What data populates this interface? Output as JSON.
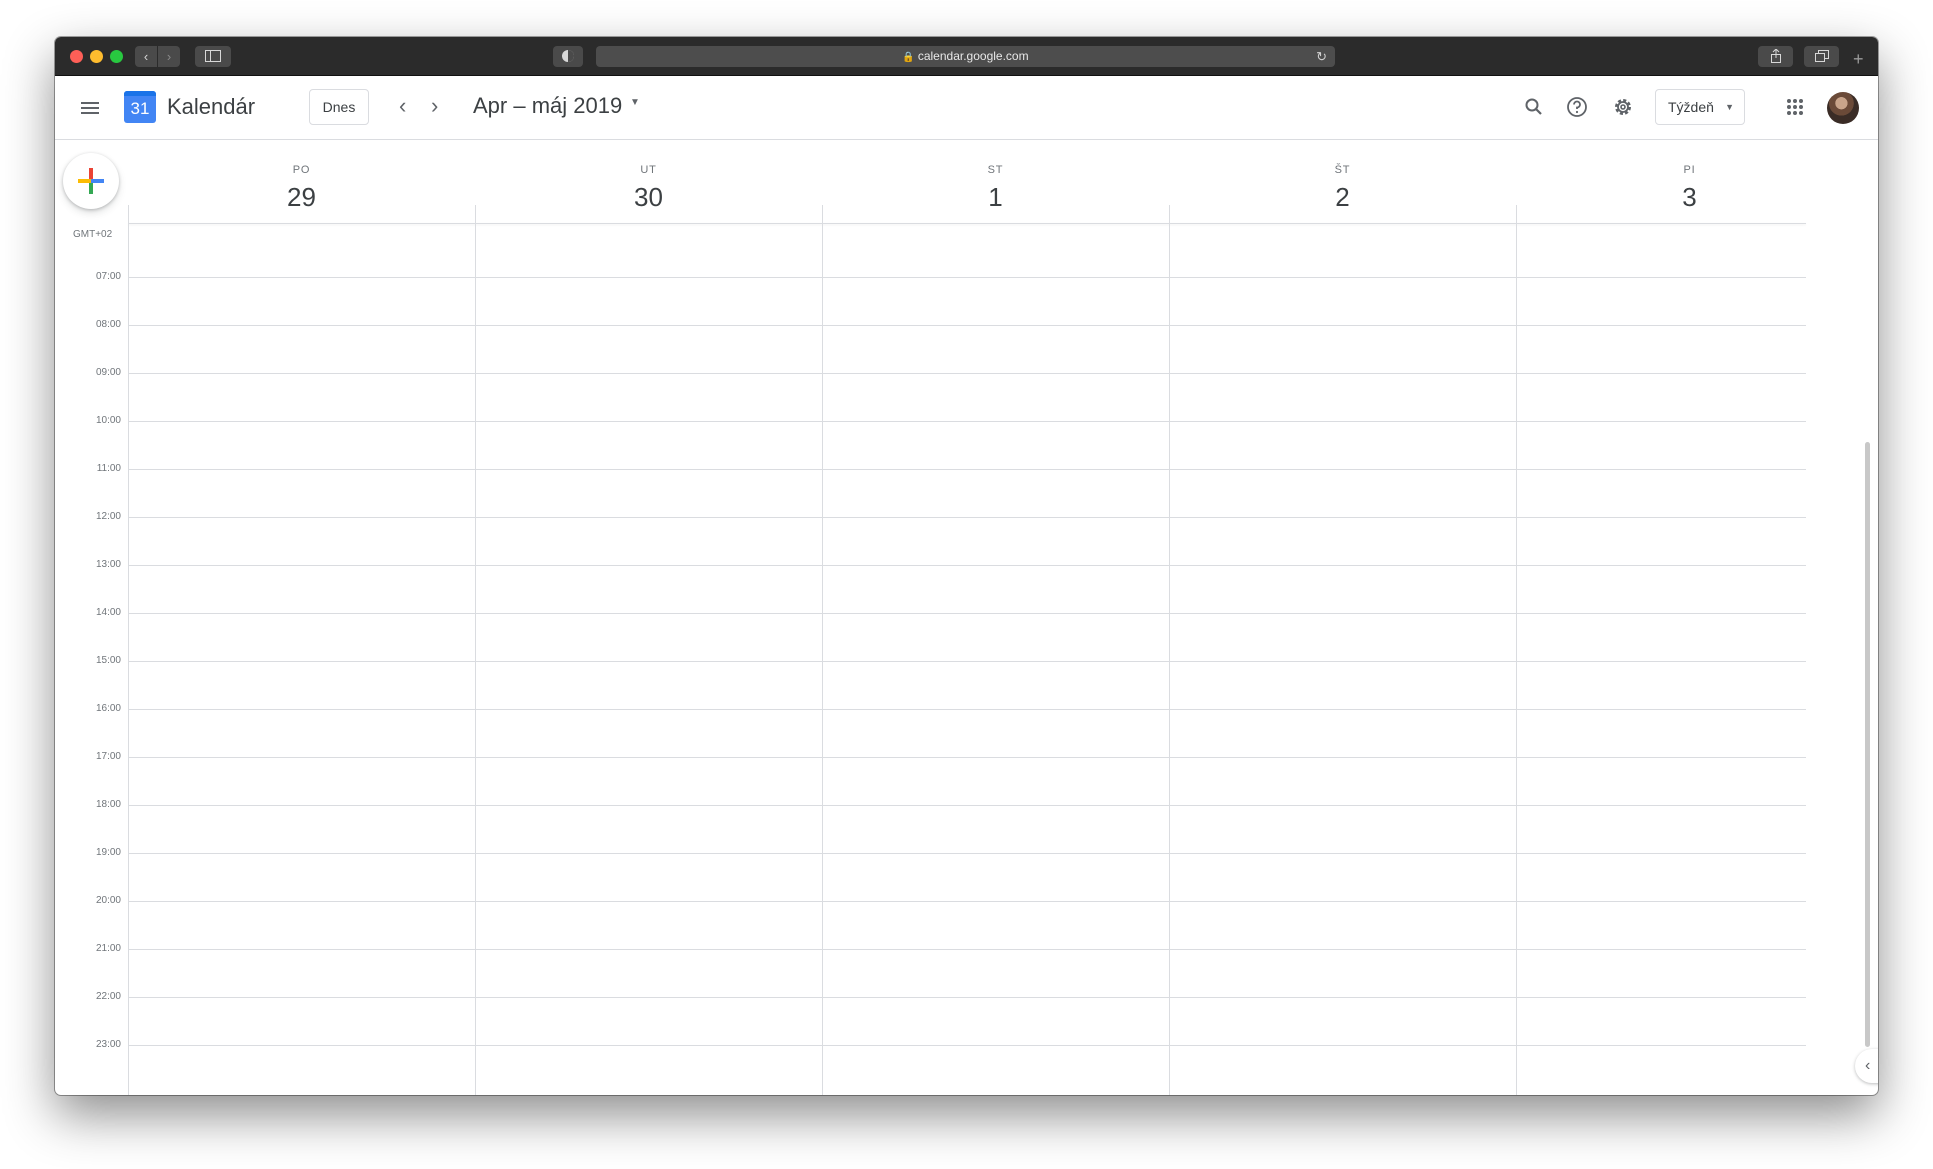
{
  "browser": {
    "url": "calendar.google.com",
    "back_icon": "‹",
    "forward_icon": "›",
    "plus_icon": "+"
  },
  "header": {
    "app_name": "Kalendár",
    "logo_number": "31",
    "today_label": "Dnes",
    "prev_icon": "‹",
    "next_icon": "›",
    "date_range": "Apr – máj 2019",
    "view_label": "Týždeň"
  },
  "days": [
    {
      "name": "PO",
      "number": "29"
    },
    {
      "name": "UT",
      "number": "30"
    },
    {
      "name": "ST",
      "number": "1"
    },
    {
      "name": "ŠT",
      "number": "2"
    },
    {
      "name": "PI",
      "number": "3"
    }
  ],
  "timezone": "GMT+02",
  "hours": [
    "07:00",
    "08:00",
    "09:00",
    "10:00",
    "11:00",
    "12:00",
    "13:00",
    "14:00",
    "15:00",
    "16:00",
    "17:00",
    "18:00",
    "19:00",
    "20:00",
    "21:00",
    "22:00",
    "23:00"
  ],
  "icons": {
    "search": "search-icon",
    "help": "help-icon",
    "settings": "gear-icon",
    "apps": "apps-grid-icon",
    "collapse": "chevron-left-icon"
  },
  "colors": {
    "brand_blue": "#4285f4",
    "grid_line": "#dadce0",
    "text": "#3c4043"
  }
}
